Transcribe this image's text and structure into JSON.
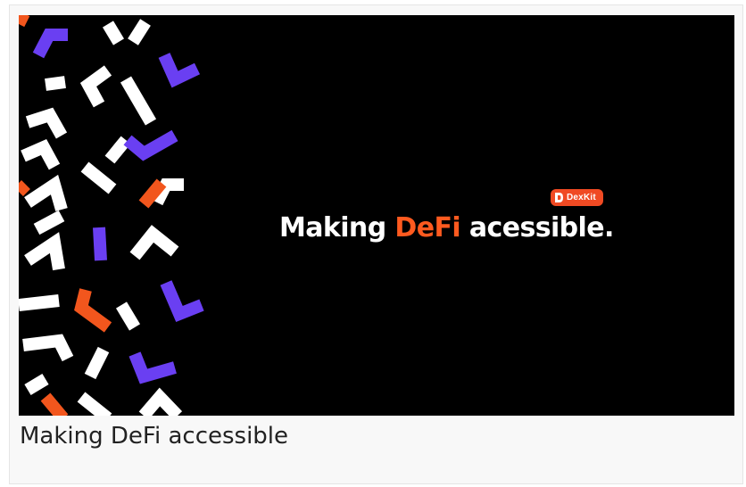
{
  "slide": {
    "headline_before": "Making ",
    "headline_accent": "DeFi",
    "headline_after": " acessible.",
    "badge_label": "DexKit"
  },
  "caption": "Making DeFi accessible",
  "colors": {
    "background": "#000000",
    "accent_orange": "#f2561d",
    "accent_purple": "#6a3ff2",
    "card_background": "#f8f8f8"
  },
  "icons": {
    "badge_logo": "dexkit-logo-icon",
    "pattern": "chevron-pattern-graphic"
  }
}
